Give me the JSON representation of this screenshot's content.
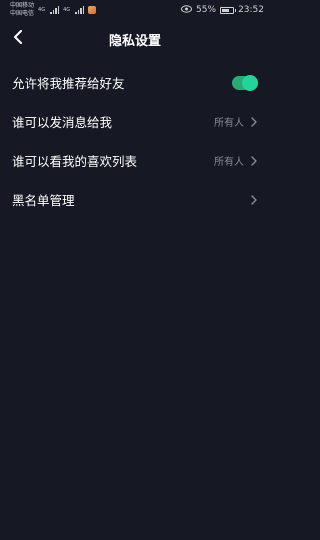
{
  "status_bar": {
    "carrier_1": "中国移动",
    "carrier_2": "中国电信",
    "net_tag_1": "4G",
    "net_tag_2": "4G",
    "battery_percent": "55%",
    "time": "23:52"
  },
  "header": {
    "title": "隐私设置"
  },
  "settings": {
    "items": [
      {
        "label": "允许将我推荐给好友",
        "toggle_on": true
      },
      {
        "label": "谁可以发消息给我",
        "value": "所有人"
      },
      {
        "label": "谁可以看我的喜欢列表",
        "value": "所有人"
      },
      {
        "label": "黑名单管理"
      }
    ]
  },
  "colors": {
    "background": "#161823",
    "toggle_track": "#2aa876",
    "toggle_knob": "#20d597",
    "secondary_text": "#8a8b91"
  },
  "icons": {
    "back": "chevron-left-icon",
    "row_arrow": "chevron-right-icon",
    "eye": "eye-icon",
    "battery": "battery-icon"
  }
}
